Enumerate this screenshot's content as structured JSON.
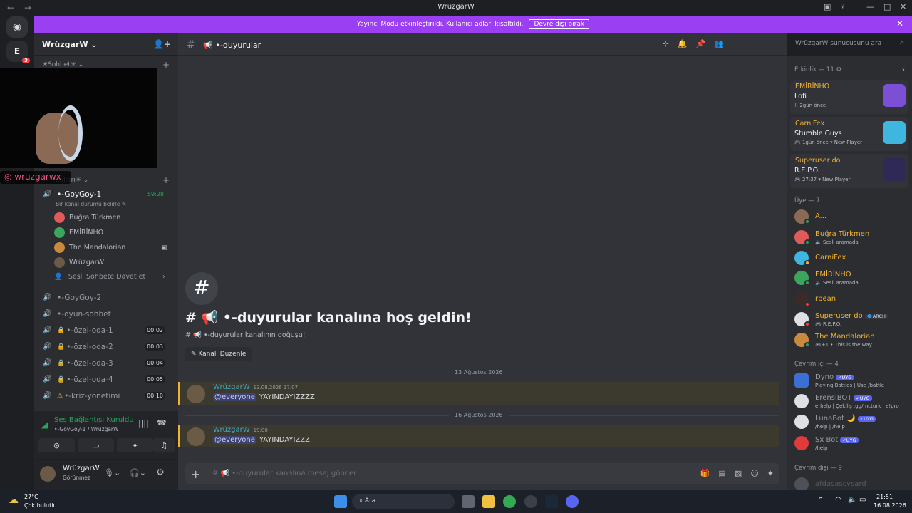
{
  "window": {
    "title": "WruzgarW",
    "back": "←",
    "forward": "→"
  },
  "banner": {
    "text": "Yayıncı Modu etkinleştirildi. Kullanıcı adları kısaltıldı.",
    "button": "Devre dışı bırak",
    "close": "✕"
  },
  "server": {
    "name": "WrüzgarW",
    "chevron": "⌄",
    "badge": "3"
  },
  "categories": [
    {
      "label": "☀Sohbet☀ ⌄"
    },
    {
      "label": "...ılları☀ ⌄"
    }
  ],
  "voice_channels": [
    {
      "name": "•-GoyGoy-1",
      "timer": "59:28",
      "status": "Bir kanal durumu belirle ✎"
    },
    {
      "name": "•-GoyGoy-2"
    },
    {
      "name": "•-oyun-sohbet"
    },
    {
      "name": "•-özel-oda-1",
      "count": "00 02"
    },
    {
      "name": "•-özel-oda-2",
      "count": "00 03"
    },
    {
      "name": "•-özel-oda-3",
      "count": "00 04"
    },
    {
      "name": "•-özel-oda-4",
      "count": "00 05"
    },
    {
      "name": "•-kriz-yönetimi",
      "count": "00 10"
    }
  ],
  "voice_users": [
    {
      "name": "Buğra Türkmen",
      "color": "#e05a5a"
    },
    {
      "name": "EMİRİNHO",
      "color": "#3ba55d"
    },
    {
      "name": "The Mandalorian",
      "color": "#c98a3e"
    },
    {
      "name": "WrüzgarW",
      "color": "#6b5a45"
    }
  ],
  "voice_invite": "Sesli Sohbete Davet et",
  "voice_panel": {
    "status": "Ses Bağlantısı Kuruldu",
    "channel": "•-GoyGoy-1 / WrüzgarW"
  },
  "user_panel": {
    "name": "WrüzgarW",
    "status": "Görünmez"
  },
  "overlay": {
    "instagram": "wruzgarwx"
  },
  "channel": {
    "name": "📢 •-duyurular"
  },
  "header_search": "WrüzgarW sunucusunu ara",
  "welcome": {
    "title": "# 📢 •-duyurular kanalına hoş geldin!",
    "subtitle": "# 📢 •-duyurular kanalının doğuşu!",
    "edit": "✎ Kanalı Düzenle"
  },
  "messages": [
    {
      "date": "13 Ağustos 2026",
      "author": "WrüzgarW",
      "time": "13.08.2026 17:07",
      "mention": "@everyone",
      "text": "YAYINDAYIZZZZ"
    },
    {
      "date": "16 Ağustos 2026",
      "author": "WrüzgarW",
      "time": "19:00",
      "mention": "@everyone",
      "text": "YAYINDAYIZZZ"
    }
  ],
  "composer_placeholder": "# 📢 •-duyurular kanalına mesaj gönder",
  "activity": {
    "header": "Etkinlik — 11 ⚙",
    "items": [
      {
        "name": "EMİRİNHO",
        "game": "Lofi",
        "meta": "⠿ 2gün önce",
        "color": "#7b4fd6"
      },
      {
        "name": "CarniFex",
        "game": "Stumble Guys",
        "meta": "🎮 1gün önce  ▾ New Player",
        "color": "#3fb6e0"
      },
      {
        "name": "Superuser do",
        "game": "R.E.P.O.",
        "meta": "🎮 27:37  ▾ New Player",
        "color": "#2e2a55"
      }
    ]
  },
  "members_header": "Üye — 7",
  "members": [
    {
      "name": "A...",
      "sub": "",
      "color": "#8a6a55",
      "status": "#23a55a"
    },
    {
      "name": "Buğra Türkmen",
      "sub": "🔈 Sesli aramada",
      "color": "#e05a5a",
      "status": "#23a55a"
    },
    {
      "name": "CarniFex",
      "sub": "",
      "color": "#3fb6e0",
      "status": "#f0b232"
    },
    {
      "name": "EMİRİNHO",
      "sub": "🔈 Sesli aramada",
      "color": "#3ba55d",
      "status": "#23a55a"
    },
    {
      "name": "rpean",
      "sub": "",
      "color": "#3a2a2a",
      "status": "#f23f43"
    },
    {
      "name": "Superuser do",
      "sub": "🎮 R.E.P.O.",
      "color": "#dfe0e6",
      "status": "#f23f43",
      "tag": "🔷ARCH"
    },
    {
      "name": "The Mandalorian",
      "sub": "🎮+1 • This is the way",
      "color": "#c98a3e",
      "status": "#23a55a"
    }
  ],
  "online_header": "Çevrim içi — 4",
  "bots": [
    {
      "name": "Dyno",
      "sub": "Playing Battles | Use /battle",
      "color": "#3b6fd6",
      "tag": "✓UYG"
    },
    {
      "name": "ErensiBOT",
      "sub": "e!help | Çekiliş .gg/mcturk | e!pro",
      "color": "#dfe0e6",
      "tag": "✓UYG"
    },
    {
      "name": "LunaBot 🌙",
      "sub": "/help | /help",
      "color": "#dfe0e6",
      "tag": "✓UYG"
    },
    {
      "name": "Sx Bot",
      "sub": "/help",
      "color": "#e03a3a",
      "tag": "✓UYG"
    }
  ],
  "offline_header": "Çevrim dışı — 9",
  "offline": [
    {
      "name": "afdasascvsard"
    }
  ],
  "taskbar": {
    "weather": "27°C",
    "weather_sub": "Çok bulutlu",
    "search": "Ara",
    "time": "21:51",
    "date": "16.08.2026"
  }
}
